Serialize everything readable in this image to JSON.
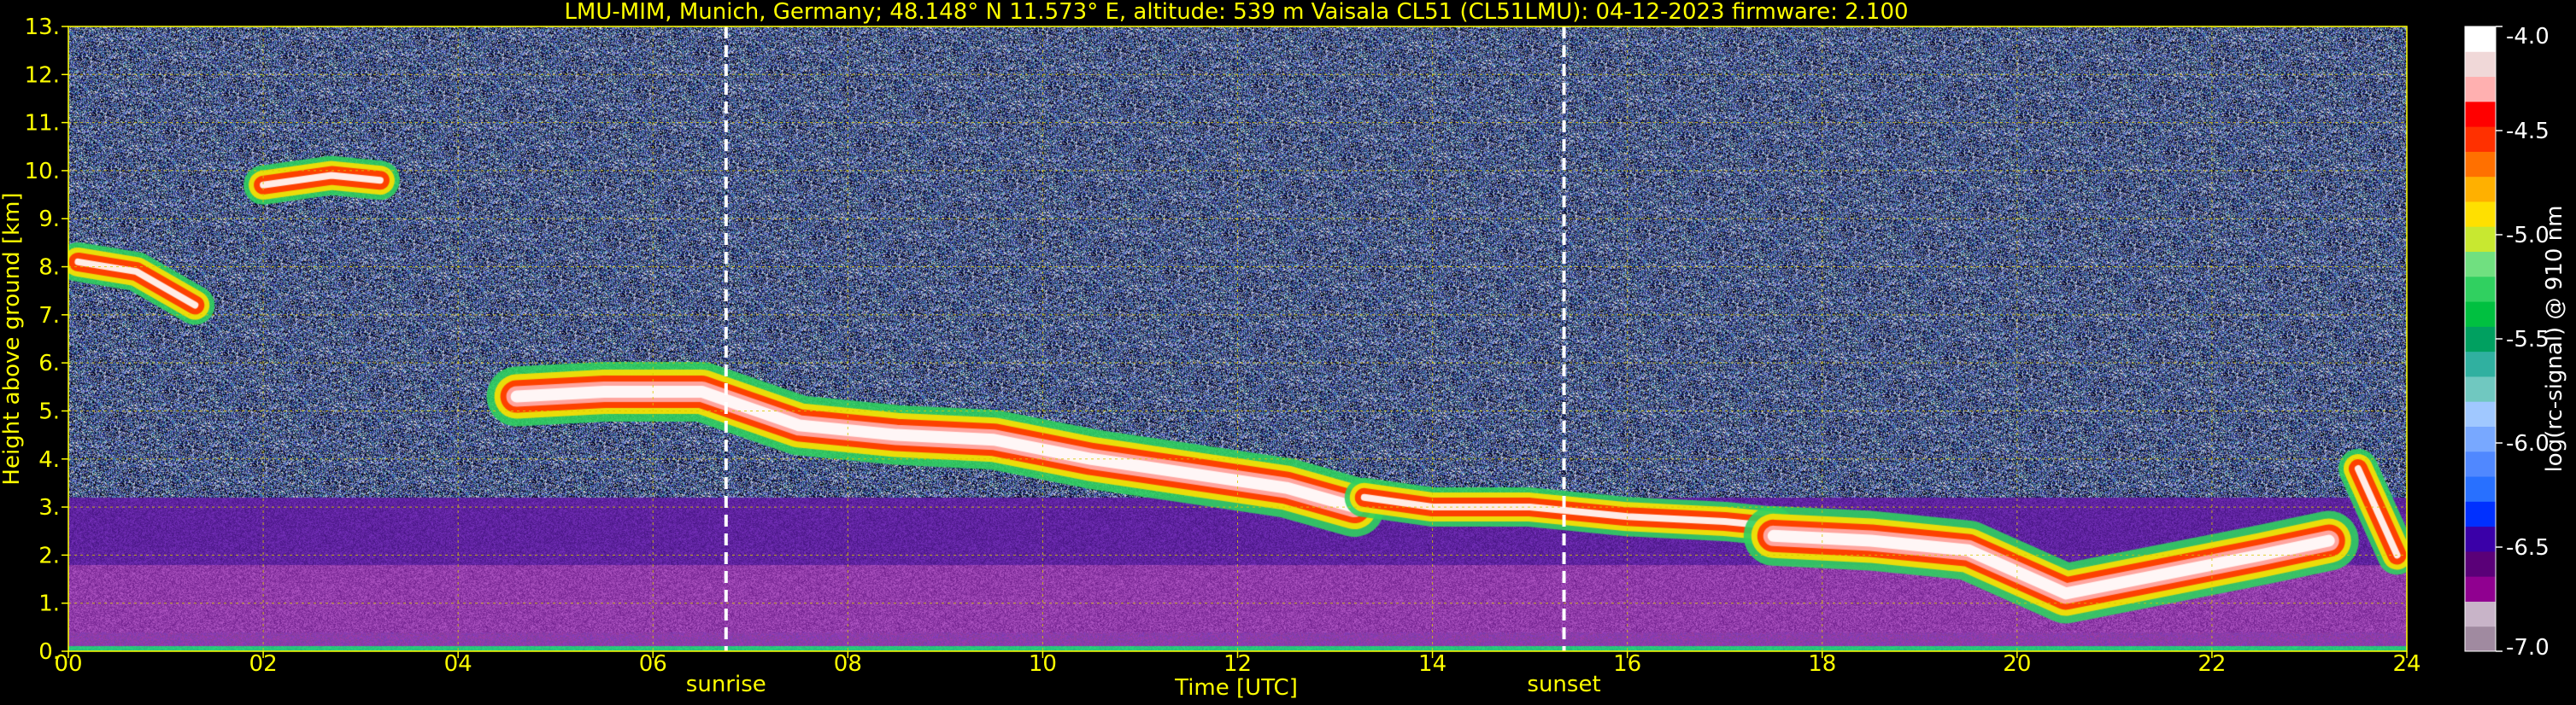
{
  "chart_data": {
    "type": "heatmap",
    "title": "LMU-MIM, Munich, Germany; 48.148° N 11.573° E, altitude: 539 m    Vaisala CL51 (CL51LMU): 04-12-2023    firmware: 2.100",
    "xlabel": "Time [UTC]",
    "ylabel": "Height above ground [km]",
    "xlim": [
      0,
      24
    ],
    "ylim": [
      0,
      13
    ],
    "x_ticks": [
      "00",
      "02",
      "04",
      "06",
      "08",
      "10",
      "12",
      "14",
      "16",
      "18",
      "20",
      "22",
      "24"
    ],
    "y_ticks": [
      "0.",
      "1.",
      "2.",
      "3.",
      "4.",
      "5.",
      "6.",
      "7.",
      "8.",
      "9.",
      "10.",
      "11.",
      "12.",
      "13."
    ],
    "grid": true,
    "colorbar": {
      "label": "log(rc-signal) @ 910 nm",
      "range": [
        -7.0,
        -4.0
      ],
      "ticks": [
        "-4.0",
        "-4.5",
        "-5.0",
        "-5.5",
        "-6.0",
        "-6.5",
        "-7.0"
      ],
      "colors": [
        "#a08aa0",
        "#c8b4c8",
        "#900090",
        "#5a0078",
        "#3a00a8",
        "#0030ff",
        "#2870ff",
        "#5088ff",
        "#78a8ff",
        "#a0c8ff",
        "#70c8c0",
        "#30b0a0",
        "#00a060",
        "#00c040",
        "#30d060",
        "#70e080",
        "#c8e830",
        "#ffe000",
        "#ffb000",
        "#ff7000",
        "#ff3000",
        "#ff0000",
        "#ffb0b0",
        "#f0d8d8",
        "#ffffff"
      ]
    },
    "events": [
      {
        "label": "sunrise",
        "time": 6.75
      },
      {
        "label": "sunset",
        "time": 15.35
      }
    ],
    "layers": [
      {
        "x": [
          0.1,
          0.7,
          1.3
        ],
        "y": [
          8.1,
          7.9,
          7.2
        ],
        "intensity": "high"
      },
      {
        "x": [
          2.0,
          2.7,
          3.2
        ],
        "y": [
          9.7,
          9.9,
          9.8
        ],
        "intensity": "high"
      },
      {
        "x": [
          4.6,
          5.5,
          6.5,
          7.5,
          8.5,
          9.5,
          10.5,
          11.5,
          12.5,
          13.2
        ],
        "y": [
          5.3,
          5.4,
          5.4,
          4.7,
          4.5,
          4.4,
          4.0,
          3.7,
          3.4,
          3.0
        ],
        "intensity": "very high"
      },
      {
        "x": [
          13.3,
          14.0,
          15.0,
          16.0,
          17.0,
          17.5
        ],
        "y": [
          3.2,
          3.0,
          3.0,
          2.8,
          2.7,
          2.6
        ],
        "intensity": "high"
      },
      {
        "x": [
          17.5,
          18.5,
          19.5,
          20.5,
          21.5,
          22.5,
          23.2
        ],
        "y": [
          2.4,
          2.3,
          2.1,
          1.2,
          1.6,
          2.0,
          2.3
        ],
        "intensity": "very high"
      },
      {
        "x": [
          23.5,
          23.9
        ],
        "y": [
          3.8,
          2.0
        ],
        "intensity": "high"
      }
    ]
  }
}
